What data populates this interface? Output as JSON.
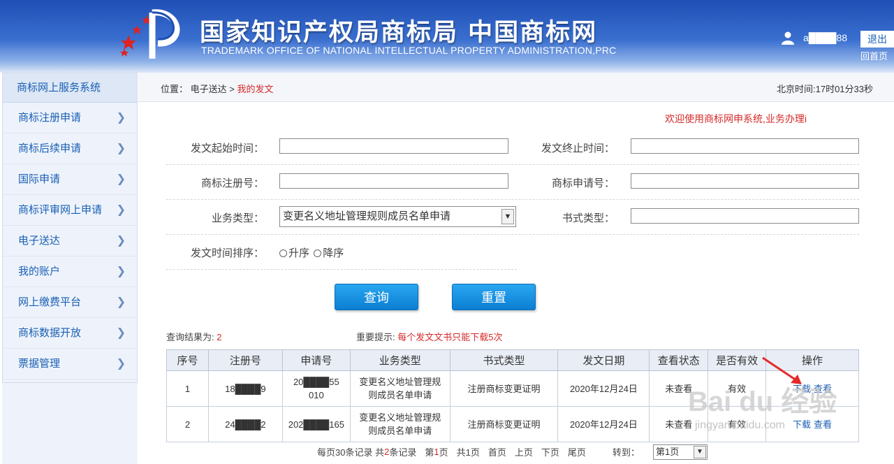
{
  "header": {
    "title": "国家知识产权局商标局 中国商标网",
    "subtitle": "TRADEMARK OFFICE OF NATIONAL INTELLECTUAL PROPERTY ADMINISTRATION,PRC",
    "username": "a████88",
    "logout_label": "退出",
    "home_label": "回首页"
  },
  "sidebar": {
    "title": "商标网上服务系统",
    "items": [
      {
        "label": "商标注册申请"
      },
      {
        "label": "商标后续申请"
      },
      {
        "label": "国际申请"
      },
      {
        "label": "商标评审网上申请"
      },
      {
        "label": "电子送达"
      },
      {
        "label": "我的账户"
      },
      {
        "label": "网上缴费平台"
      },
      {
        "label": "商标数据开放"
      },
      {
        "label": "票据管理"
      }
    ]
  },
  "breadcrumb": {
    "prefix": "位置：",
    "parent": "电子送达",
    "sep": ">",
    "current": "我的发文"
  },
  "beijing_time": "北京时间:17时01分33秒",
  "welcome": "欢迎使用商标网申系统,业务办理i",
  "form": {
    "start_time_label": "发文起始时间：",
    "start_time_value": "",
    "end_time_label": "发文终止时间：",
    "end_time_value": "",
    "reg_no_label": "商标注册号：",
    "reg_no_value": "",
    "app_no_label": "商标申请号：",
    "app_no_value": "",
    "biz_type_label": "业务类型：",
    "biz_type_selected": "变更名义地址管理规则成员名单申请",
    "doc_type_label": "书式类型：",
    "doc_type_value": "",
    "sort_label": "发文时间排序：",
    "sort_asc": "升序",
    "sort_desc": "降序"
  },
  "buttons": {
    "query": "查询",
    "reset": "重置"
  },
  "results": {
    "count_label": "查询结果为:",
    "count": "2",
    "tip_label": "重要提示:",
    "tip_text": "每个发文文书只能下载5次",
    "columns": [
      "序号",
      "注册号",
      "申请号",
      "业务类型",
      "书式类型",
      "发文日期",
      "查看状态",
      "是否有效",
      "操作"
    ],
    "rows": [
      {
        "seq": "1",
        "reg_no": "18████9",
        "app_no_top": "20████55",
        "app_no_bottom": "010",
        "biz_type": "变更名义地址管理规则成员名单申请",
        "doc_type": "注册商标变更证明",
        "date": "2020年12月24日",
        "view_status": "未查看",
        "valid": "有效",
        "op_download": "下载",
        "op_view": "查看"
      },
      {
        "seq": "2",
        "reg_no": "24████2",
        "app_no_top": "202████165",
        "app_no_bottom": "",
        "biz_type": "变更名义地址管理规则成员名单申请",
        "doc_type": "注册商标变更证明",
        "date": "2020年12月24日",
        "view_status": "未查看",
        "valid": "有效",
        "op_download": "下载",
        "op_view": "查看"
      }
    ]
  },
  "pager": {
    "per_page_prefix": "每页30条记录 共 ",
    "total": "2",
    "total_suffix": "条记录",
    "page_prefix": "第",
    "page_current": "1",
    "page_suffix": "页",
    "total_pages": "共1页",
    "first": "首页",
    "prev": "上页",
    "next": "下页",
    "last": "尾页",
    "goto_label": "转到：",
    "goto_selected": "第1页"
  },
  "watermark": {
    "main": "Bai du 经验",
    "sub": "jingyan.baidu.com"
  },
  "colors": {
    "header_blue": "#1f4fb5",
    "link_blue": "#1a5fb4",
    "accent_red": "#d62a2a",
    "button_blue": "#0b7fd4"
  }
}
